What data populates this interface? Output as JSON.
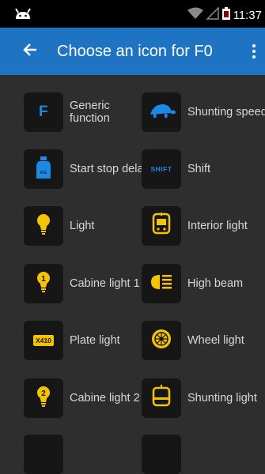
{
  "status_bar": {
    "time": "11:37"
  },
  "app_bar": {
    "title": "Choose an icon for F0"
  },
  "icons": [
    {
      "label": "Generic function",
      "icon": "f-letter-icon"
    },
    {
      "label": "Shunting speed",
      "icon": "turtle-icon"
    },
    {
      "label": "Start stop delay",
      "icon": "weight-bottle-icon",
      "badge": "KG"
    },
    {
      "label": "Shift",
      "icon": "shift-icon",
      "badge": "SHIFT"
    },
    {
      "label": "Light",
      "icon": "light-bulb-icon"
    },
    {
      "label": "Interior light",
      "icon": "interior-light-icon"
    },
    {
      "label": "Cabine light 1",
      "icon": "cabine-light-1-icon",
      "badge": "1"
    },
    {
      "label": "High beam",
      "icon": "high-beam-icon"
    },
    {
      "label": "Plate light",
      "icon": "plate-light-icon",
      "badge": "X410"
    },
    {
      "label": "Wheel light",
      "icon": "wheel-light-icon"
    },
    {
      "label": "Cabine light 2",
      "icon": "cabine-light-2-icon",
      "badge": "2"
    },
    {
      "label": "Shunting light",
      "icon": "shunting-light-icon"
    }
  ],
  "colors": {
    "app_bar": "#1f73c3",
    "background": "#2e2e2e",
    "tile": "#161616",
    "accent_yellow": "#f5c400",
    "accent_blue": "#1e88e5"
  }
}
